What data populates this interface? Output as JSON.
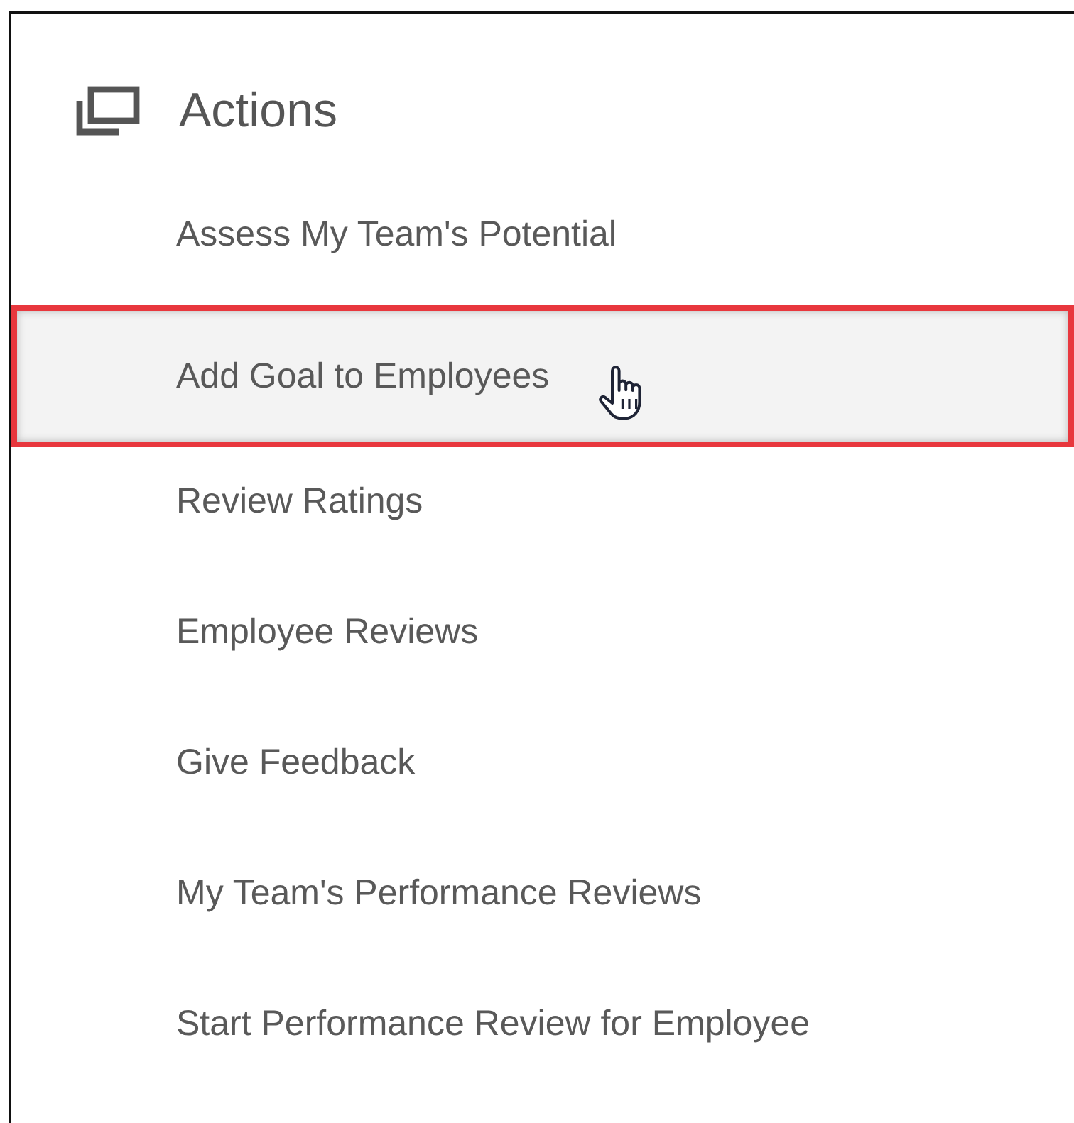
{
  "panel": {
    "title": "Actions",
    "items": [
      {
        "label": "Assess My Team's Potential",
        "selected": false
      },
      {
        "label": "Add Goal to Employees",
        "selected": true
      },
      {
        "label": "Review Ratings",
        "selected": false
      },
      {
        "label": "Employee Reviews",
        "selected": false
      },
      {
        "label": "Give Feedback",
        "selected": false
      },
      {
        "label": "My Team's Performance Reviews",
        "selected": false
      },
      {
        "label": "Start Performance Review for Employee",
        "selected": false
      }
    ]
  }
}
